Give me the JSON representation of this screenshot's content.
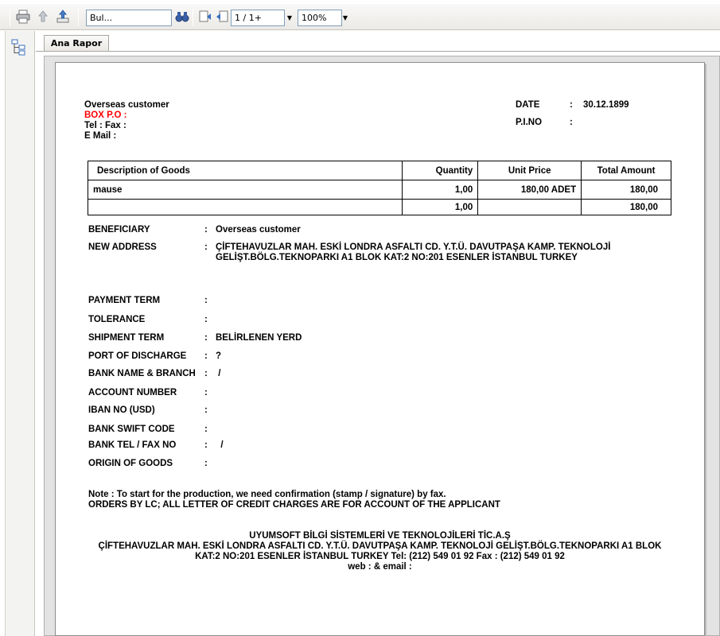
{
  "toolbar": {
    "search_value": "Bul...",
    "page_value": "1 / 1+",
    "zoom_value": "100%",
    "icons": [
      "print-icon",
      "export-up-icon",
      "export-icon",
      "find-binoculars-icon",
      "first-page-icon",
      "prev-page-icon"
    ]
  },
  "tabs": [
    {
      "label": "Ana Rapor"
    }
  ],
  "report": {
    "customer_name": "Overseas customer",
    "box_po": "BOX P.O :",
    "tel_fax": "Tel :  Fax :",
    "email": "E Mail :",
    "date_label": "DATE",
    "date_colon": ":",
    "date_value": "30.12.1899",
    "pino_label": "P.I.NO",
    "pino_colon": ":",
    "table": {
      "headers": [
        "Description of Goods",
        "Quantity",
        "Unit Price",
        "Total Amount"
      ],
      "rows": [
        [
          "mause",
          "1,00",
          "180,00 ADET",
          "180,00"
        ],
        [
          "",
          "1,00",
          "",
          "180,00"
        ]
      ]
    },
    "fields": [
      {
        "label": "BENEFICIARY",
        "value": "Overseas customer"
      },
      {
        "label": "NEW ADDRESS",
        "value": "ÇİFTEHAVUZLAR MAH. ESKİ LONDRA ASFALTI CD. Y.T.Ü. DAVUTPAŞA KAMP. TEKNOLOJİ",
        "value2": "GELİŞT.BÖLG.TEKNOPARKI A1 BLOK KAT:2 NO:201  ESENLER İSTANBUL TURKEY"
      },
      {
        "label": "PAYMENT TERM",
        "value": ""
      },
      {
        "label": "TOLERANCE",
        "value": ""
      },
      {
        "label": "SHIPMENT TERM",
        "value": "BELİRLENEN YERD"
      },
      {
        "label": "PORT OF DISCHARGE",
        "value": "?"
      },
      {
        "label": "BANK NAME & BRANCH",
        "value": " /"
      },
      {
        "label": "ACCOUNT NUMBER",
        "value": ""
      },
      {
        "label": "IBAN NO (USD)",
        "value": ""
      },
      {
        "label": "BANK SWIFT CODE",
        "value": ""
      },
      {
        "label": "BANK TEL / FAX NO",
        "value": "  /"
      },
      {
        "label": "ORIGIN OF GOODS",
        "value": ""
      }
    ],
    "colon": ":",
    "note_line1": "Note : To start for the production, we need confirmation (stamp / signature) by fax.",
    "note_line2": "ORDERS BY LC; ALL LETTER OF CREDIT CHARGES ARE FOR ACCOUNT OF THE APPLICANT",
    "footer": [
      "UYUMSOFT BİLGİ SİSTEMLERİ VE TEKNOLOJİLERİ TİC.A.Ş",
      "ÇİFTEHAVUZLAR MAH. ESKİ LONDRA ASFALTI CD. Y.T.Ü. DAVUTPAŞA KAMP. TEKNOLOJİ GELİŞT.BÖLG.TEKNOPARKI A1 BLOK",
      "KAT:2 NO:201  ESENLER İSTANBUL TURKEY Tel: (212) 549 01 92 Fax : (212) 549 01 92",
      "web :  & email :"
    ]
  }
}
